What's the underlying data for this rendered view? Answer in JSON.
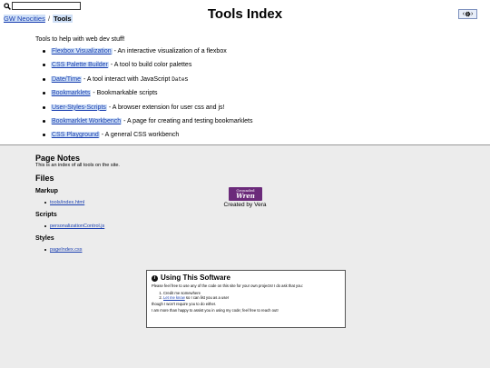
{
  "header": {
    "search_value": "",
    "breadcrumb_home": "GW Neocities",
    "breadcrumb_sep": "/",
    "breadcrumb_current": "Tools",
    "title": "Tools Index",
    "settings_icon": "gear-icon"
  },
  "main": {
    "intro": "Tools to help with web dev stuff!",
    "tools": [
      {
        "label": "Flexbox Visualization",
        "desc": " - An interactive visualization of a flexbox"
      },
      {
        "label": "CSS Palette Builder",
        "desc": " - A tool to build color palettes"
      },
      {
        "label": "Date/Time",
        "desc": " - A tool interact with JavaScript ",
        "code": "Date",
        "suffix": "s"
      },
      {
        "label": "Bookmarklets",
        "desc": " - Bookmarkable scripts"
      },
      {
        "label": "User-Styles-Scripts",
        "desc": " - A browser extension for user css and js!"
      },
      {
        "label": "Bookmarklet Workbench",
        "desc": " - A page for creating and testing bookmarklets"
      },
      {
        "label": "CSS Playground",
        "desc": " - A general CSS workbench"
      }
    ]
  },
  "notes": {
    "heading": "Page Notes",
    "desc": "This is an index of all tools on the site.",
    "files_heading": "Files",
    "markup_heading": "Markup",
    "markup_file": "tools/index.html",
    "scripts_heading": "Scripts",
    "scripts_file": "personalizationControl.js",
    "styles_heading": "Styles",
    "styles_file": "pageIndex.css"
  },
  "use_box": {
    "title": "Using This Software",
    "intro": "Please feel free to use any of the code on this site for your own projects! I do ask that you:",
    "item1": "Credit me somewhere",
    "item2_link": "Let me know",
    "item2_rest": " so I can list you as a user",
    "note1": "though I won't require you to do either.",
    "note2": "I am more than happy to assist you in using my code; feel free to reach out!"
  },
  "footer": {
    "logo_top": "Grounded",
    "logo_main": "Wren",
    "credit": "Created by Vera"
  }
}
